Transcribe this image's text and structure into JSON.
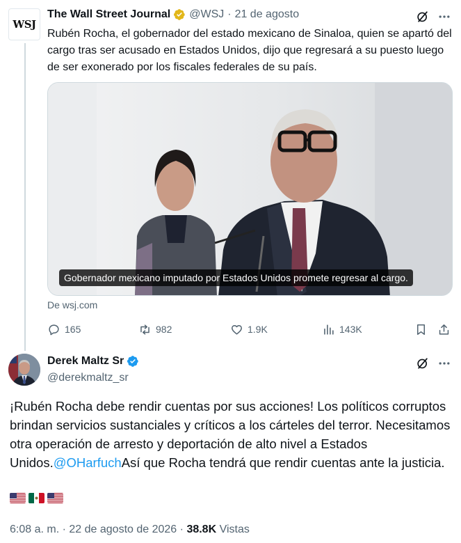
{
  "tweet1": {
    "author_name": "The Wall Street Journal",
    "author_handle": "@WSJ",
    "separator": "·",
    "date": "21 de agosto",
    "logo_text": "WSJ",
    "text": "Rubén Rocha, el gobernador del estado mexicano de Sinaloa, quien se apartó del cargo tras ser acusado en Estados Unidos, dijo que regresará a su puesto luego de ser exonerado por los fiscales federales de su país.",
    "media_caption": "Gobernador mexicano imputado por Estados Unidos promete regresar al cargo.",
    "link_source": "De wsj.com",
    "actions": {
      "replies": "165",
      "reposts": "982",
      "likes": "1.9K",
      "views": "143K"
    },
    "badge_color": "#e2b719"
  },
  "tweet2": {
    "author_name": "Derek Maltz Sr",
    "author_handle": "@derekmaltz_sr",
    "text_before": "¡Rubén Rocha debe rendir cuentas por sus acciones! Los políticos corruptos brindan servicios sustanciales y críticos a los cárteles del terror. Necesitamos otra operación de arresto y deportación de alto nivel a Estados Unidos.",
    "mention": "@OHarfuch",
    "text_after": "Así que Rocha tendrá que rendir cuentas ante la justicia.",
    "flags": [
      "us-flag",
      "mx-flag",
      "us-flag"
    ],
    "time": "6:08 a. m.",
    "separator": "·",
    "date": "22 de agosto de 2026",
    "views_count": "38.8K",
    "views_label": "Vistas",
    "badge_color": "#1d9bf0",
    "mention_color": "#1d9bf0"
  }
}
